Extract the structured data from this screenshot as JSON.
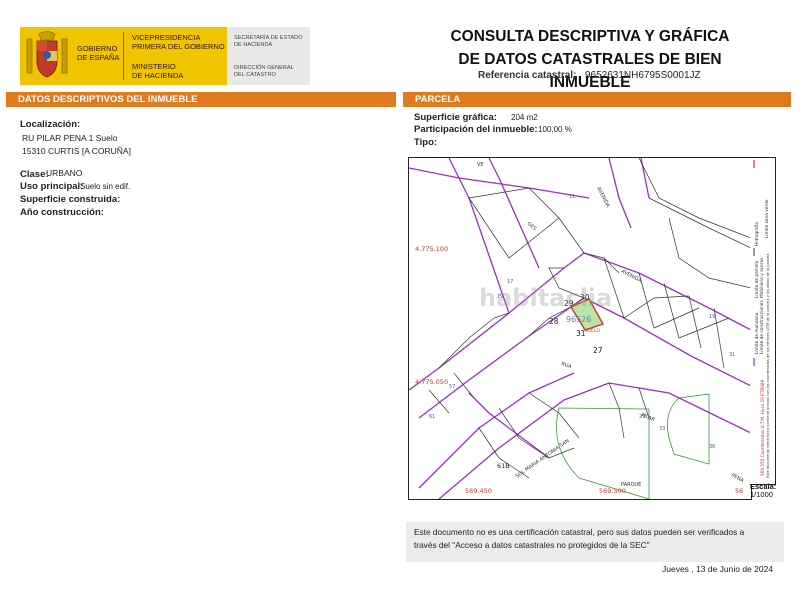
{
  "header": {
    "gov_line1": "GOBIERNO",
    "gov_line2": "DE ESPAÑA",
    "vice_line1": "VICEPRESIDENCIA",
    "vice_line2": "PRIMERA DEL GOBIERNO",
    "min_line1": "MINISTERIO",
    "min_line2": "DE HACIENDA",
    "sec_line1": "SECRETARÍA DE ESTADO",
    "sec_line2": "DE HACIENDA",
    "dir_line1": "DIRECCIÓN GENERAL",
    "dir_line2": "DEL CATASTRO",
    "title_line1": "CONSULTA DESCRIPTIVA Y GRÁFICA",
    "title_line2": "DE DATOS CATASTRALES DE BIEN INMUEBLE",
    "ref_label": "Referencia catastral:",
    "ref_value": "9652631NH6795S0001JZ"
  },
  "left": {
    "section_title": "DATOS DESCRIPTIVOS DEL INMUEBLE",
    "localizacion_label": "Localización:",
    "localizacion_line1": "RU PILAR PENA 1 Suelo",
    "localizacion_line2": "15310 CURTIS [A CORUÑA]",
    "clase_label": "Clase:",
    "clase_value": "URBANO",
    "uso_label": "Uso principal:",
    "uso_value": "Suelo sin edif.",
    "superficie_label": "Superficie construida:",
    "anio_label": "Año construcción:"
  },
  "right": {
    "section_title": "PARCELA",
    "superficie_label": "Superficie gráfica:",
    "superficie_value": "204 m2",
    "participacion_label": "Participación del inmueble:",
    "participacion_value": "100,00 %",
    "tipo_label": "Tipo:"
  },
  "map": {
    "coord_y1": "4.775.100",
    "coord_y2": "4.775.050",
    "coord_x1": "569.450",
    "coord_x2": "569.500",
    "coord_x3": "56",
    "parcel_ref": "96526",
    "parcel_sub": "SUELO",
    "num_28": "28",
    "num_29": "29",
    "num_30": "30",
    "num_31": "31",
    "num_27": "27",
    "num_61b": "61B",
    "street_avenida1": "AVENIDA",
    "street_avenida2": "AVENIDA",
    "street_ges": "GES",
    "street_rua": "RUA",
    "street_pilar": "PILAR",
    "street_pena": "PENA",
    "street_sol": "SOL MARIA ANTONIA SAN",
    "street_parque": "PARQUE",
    "street_top": "VE",
    "watermark": "habitaclia",
    "legend_1": "Límite de parcela",
    "legend_2": "Mobiliario y aceras",
    "legend_3": "Hidrografía",
    "legend_4": "Límite de manzana",
    "legend_5": "Límite de construcciones",
    "legend_6": "Límite zona verde",
    "legend_note": "Este documento electrónico contiene anexos con las coordenadas de los vértices UTM de la parcela y los datos de la parcela",
    "legend_coord": "569.550 Coordenadas U.T.M. Huso 29 ETRS89",
    "scale_label": "Escala:",
    "scale_value": "1/1000"
  },
  "footer": {
    "note_line1": "Este documento no es una certificación catastral, pero sus datos pueden ser verificados a",
    "note_line2": "través del \"Acceso a datos catastrales no protegidos de la SEC\"",
    "date": "Jueves , 13 de Junio de 2024"
  },
  "colors": {
    "accent_orange": "#e07a1f",
    "gov_yellow": "#f2c300",
    "parcel_green": "#b9e6a4",
    "street_purple": "#9b30c0",
    "coord_red": "#c0392b"
  }
}
